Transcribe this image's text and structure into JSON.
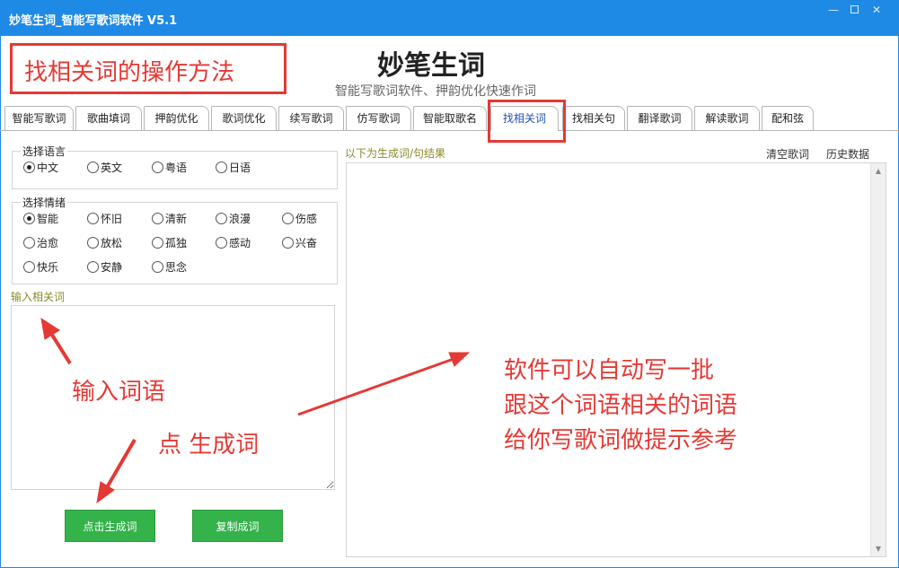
{
  "window": {
    "title": "妙笔生词_智能写歌词软件 V5.1",
    "min_glyph": "—",
    "close_glyph": "✕"
  },
  "header": {
    "app_name": "妙笔生词",
    "subtitle": "智能写歌词软件、押韵优化快速作词"
  },
  "tabs": [
    {
      "label": "智能写歌词"
    },
    {
      "label": "歌曲填词"
    },
    {
      "label": "押韵优化"
    },
    {
      "label": "歌词优化"
    },
    {
      "label": "续写歌词"
    },
    {
      "label": "仿写歌词"
    },
    {
      "label": "智能取歌名"
    },
    {
      "label": "找相关词",
      "active": true
    },
    {
      "label": "找相关句"
    },
    {
      "label": "翻译歌词"
    },
    {
      "label": "解读歌词"
    },
    {
      "label": "配和弦"
    }
  ],
  "language": {
    "label": "选择语言",
    "options": [
      "中文",
      "英文",
      "粤语",
      "日语"
    ],
    "selected": "中文"
  },
  "mood": {
    "label": "选择情绪",
    "options": [
      "智能",
      "怀旧",
      "清新",
      "浪漫",
      "伤感",
      "治愈",
      "放松",
      "孤独",
      "感动",
      "兴奋",
      "快乐",
      "安静",
      "思念"
    ],
    "selected": "智能"
  },
  "input": {
    "label": "输入相关词"
  },
  "buttons": {
    "generate": "点击生成词",
    "copy": "复制成词"
  },
  "result": {
    "label": "以下为生成词/句结果",
    "clear": "清空歌词",
    "history": "历史数据",
    "scroll_up": "▲",
    "scroll_down": "▼"
  },
  "annotations": {
    "title": "找相关词的操作方法",
    "input_hint": "输入词语",
    "click_hint": "点 生成词",
    "desc_lines": [
      "软件可以自动写一批",
      "跟这个词语相关的词语",
      "给你写歌词做提示参考"
    ],
    "color": "#e53935"
  },
  "colors": {
    "titlebar": "#1e8ae6",
    "button_green": "#33b34a",
    "active_tab_text": "#1f4fb4"
  }
}
